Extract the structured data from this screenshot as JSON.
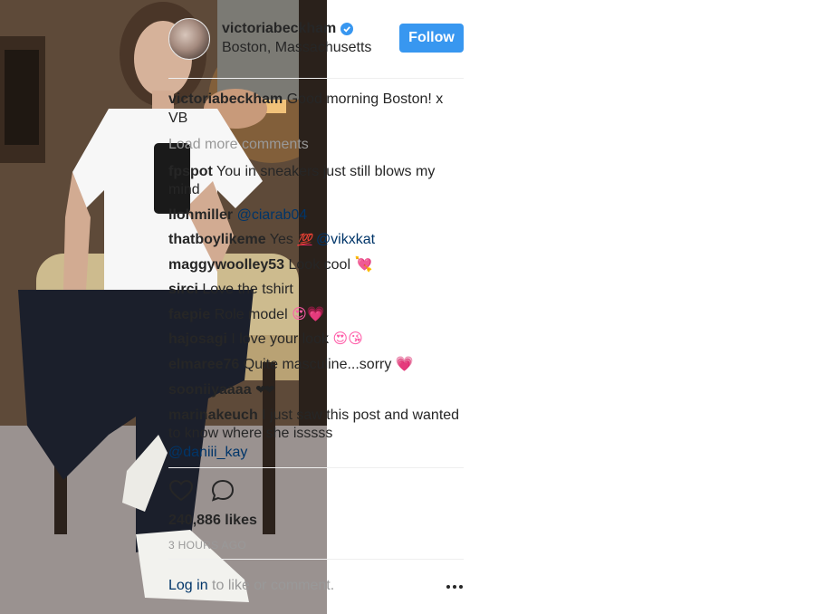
{
  "post": {
    "username": "victoriabeckham",
    "location": "Boston, Massachusetts",
    "follow_label": "Follow",
    "caption_user": "victoriabeckham",
    "caption_text": "Good morning Boston! x VB",
    "load_more_label": "Load more comments",
    "likes": "240,886 likes",
    "time": "3 HOURS AGO",
    "login_label": "Log in",
    "login_suffix": " to like or comment."
  },
  "comments": [
    {
      "user": "fpspot",
      "text": "You in sneakers just still blows my mind"
    },
    {
      "user": "llohmiller",
      "mention": "@ciarab04"
    },
    {
      "user": "thatboylikeme",
      "text": "Yes ",
      "emoji": "💯",
      "mention": "@vikxkat"
    },
    {
      "user": "maggywoolley53",
      "text": "Look cool ",
      "emoji": "💘"
    },
    {
      "user": "sirci",
      "text": "Love the tshirt"
    },
    {
      "user": "faepie",
      "text": "Role model ",
      "emoji": "😍💗"
    },
    {
      "user": "hajosagi",
      "text": "I love your look ",
      "emoji": "😍😘"
    },
    {
      "user": "elmaree76",
      "text": "Quite masculine...sorry ",
      "emoji": "💗"
    },
    {
      "user": "sooniiyaaaa",
      "emoji": "❤❤"
    },
    {
      "user": "marinakeuch",
      "text": "I just saw this post and wanted to know where she isssss",
      "mention": "@daniii_kay"
    }
  ],
  "icons": {
    "verified": "verified-badge-icon",
    "like": "heart-icon",
    "comment": "comment-bubble-icon",
    "more": "more-options-icon"
  },
  "colors": {
    "accent": "#3897f0",
    "link": "#003569",
    "muted": "#999999"
  }
}
